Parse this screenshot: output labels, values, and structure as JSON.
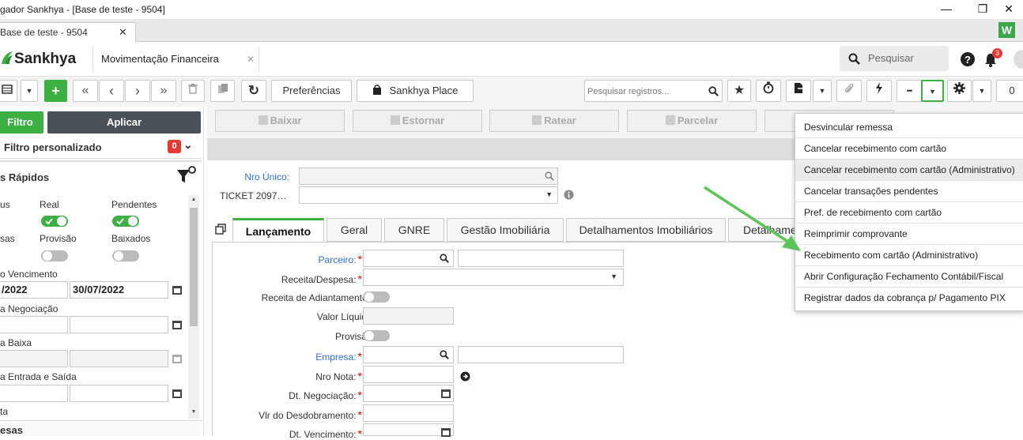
{
  "window": {
    "title": "gador Sankhya - [Base de teste - 9504]",
    "minimize": "—",
    "maximize": "❐",
    "close": "✕"
  },
  "browser_tab": {
    "label": "Base de teste - 9504",
    "close": "✕",
    "w_logo": "W"
  },
  "header": {
    "logo": "Sankhya",
    "app_tab": "Movimentação Financeira",
    "app_tab_close": "✕",
    "search_placeholder": "Pesquisar",
    "notification_count": "3"
  },
  "toolbar": {
    "add": "+",
    "first": "«",
    "prev": "‹",
    "next": "›",
    "last": "»",
    "refresh": "↻",
    "preferences": "Preferências",
    "place": "Sankhya Place",
    "search_records_placeholder": "Pesquisar registros...",
    "more": "•••",
    "counter": "0"
  },
  "sidebar": {
    "filter_button": "Filtro",
    "apply_button": "Aplicar",
    "custom_filter": "Filtro personalizado",
    "custom_filter_count": "0",
    "quick_filters_title": "s Rápidos",
    "col1_row1": "us",
    "real": "Real",
    "pendentes": "Pendentes",
    "col1_row2": "sas",
    "provisao": "Provisão",
    "baixados": "Baixados",
    "vencimento": "o Vencimento",
    "date_start": "/2022",
    "date_end": "30/07/2022",
    "negociacao": "a Negociação",
    "baixa": "a Baixa",
    "entrada_saida": "a Entrada e Saída",
    "last_label": "ta",
    "section2": "esas"
  },
  "actions": {
    "baixar": "Baixar",
    "estornar": "Estornar",
    "ratear": "Ratear",
    "parcelar": "Parcelar"
  },
  "form": {
    "nro_unico_label": "Nro Único:",
    "ticket_label": "TICKET 2097…",
    "tabs": [
      "Lançamento",
      "Geral",
      "GNRE",
      "Gestão Imobiliária",
      "Detalhamentos Imobiliários",
      "Detalhame"
    ],
    "fields": {
      "parceiro": "Parceiro:",
      "receita_despesa": "Receita/Despesa:",
      "receita_adiantamentos": "Receita de Adiantamentos:",
      "valor_liquido": "Valor Líquido:",
      "provisao": "Provisão:",
      "empresa": "Empresa:",
      "nro_nota": "Nro Nota:",
      "dt_negociacao": "Dt. Negociação:",
      "vlr_desdobramento": "Vlr do Desdobramento:",
      "dt_vencimento": "Dt. Vencimento:"
    }
  },
  "dropdown": {
    "items": [
      "Desvincular remessa",
      "Cancelar recebimento com cartão",
      "Cancelar recebimento com cartão (Administrativo)",
      "Cancelar transações pendentes",
      "Pref. de recebimento com cartão",
      "Reimprimir comprovante",
      "Recebimento com cartão (Administrativo)",
      "Abrir Configuração Fechamento Contábil/Fiscal",
      "Registrar dados da cobrança p/ Pagamento PIX"
    ]
  },
  "colors": {
    "accent": "#3cb043",
    "link_blue": "#2f6fd6",
    "required": "#dd0000",
    "badge": "#e53935"
  }
}
